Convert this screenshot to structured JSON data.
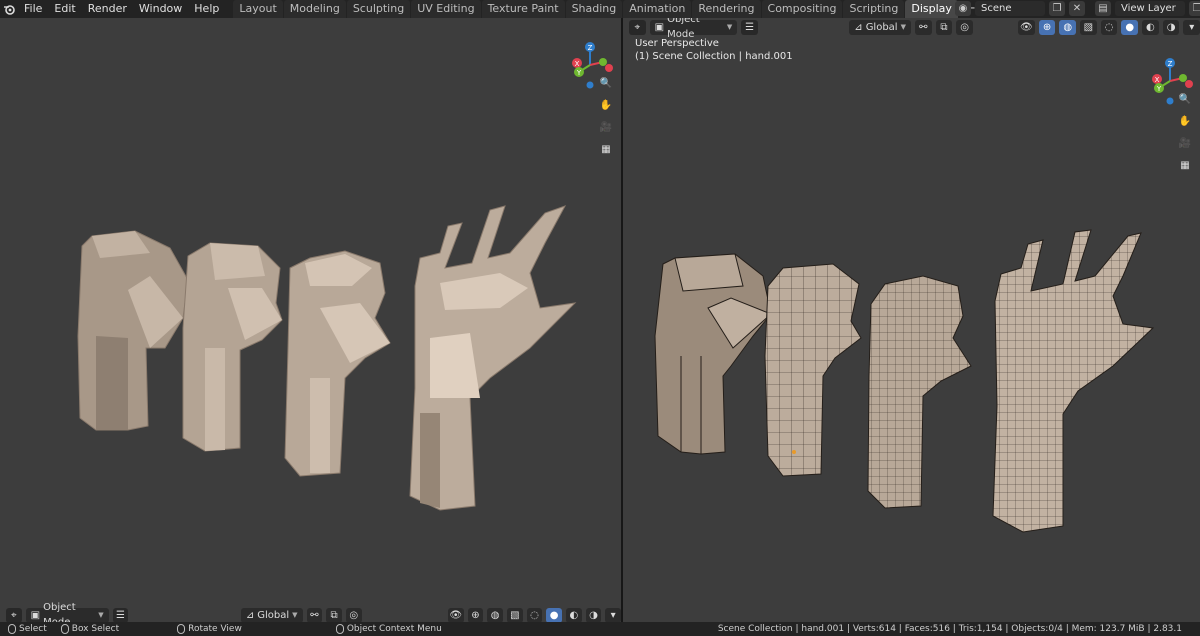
{
  "menu": [
    "File",
    "Edit",
    "Render",
    "Window",
    "Help"
  ],
  "workspaces": [
    "Layout",
    "Modeling",
    "Sculpting",
    "UV Editing",
    "Texture Paint",
    "Shading",
    "Animation",
    "Rendering",
    "Compositing",
    "Scripting",
    "Display"
  ],
  "active_workspace": "Display",
  "scene": {
    "label": "Scene",
    "view_layer": "View Layer"
  },
  "left_viewport": {
    "mode": "Object Mode",
    "orientation": "Global"
  },
  "right_viewport": {
    "mode": "Object Mode",
    "orientation": "Global",
    "perspective": "User Perspective",
    "collection_info": "(1) Scene Collection | hand.001"
  },
  "gizmo_axes": {
    "z": "Z",
    "x": "X",
    "y": "Y"
  },
  "status": {
    "select": "Select",
    "box_select": "Box Select",
    "rotate_view": "Rotate View",
    "context_menu": "Object Context Menu",
    "stats": "Scene Collection | hand.001 | Verts:614 | Faces:516 | Tris:1,154 | Objects:0/4 | Mem: 123.7 MiB | 2.83.1"
  },
  "colors": {
    "viewport_bg": "#3d3d3d",
    "active_tab": "#474747",
    "axis_x": "#e0414f",
    "axis_y": "#6fb830",
    "axis_z": "#2f7ecc",
    "mesh": "#b5a595"
  }
}
